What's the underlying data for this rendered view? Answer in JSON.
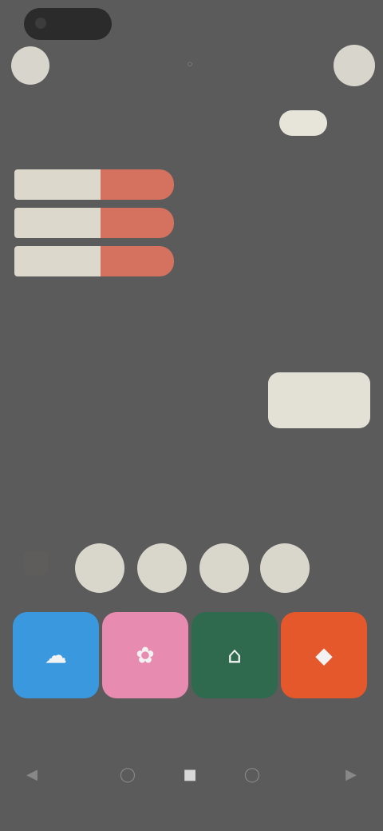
{
  "header": {
    "title": "",
    "center_icon": "◦"
  },
  "palette": {
    "rows": [
      {
        "left_color": "#dcd8cc",
        "right_color": "#d4725f"
      },
      {
        "left_color": "#dcd8cc",
        "right_color": "#d4725f"
      },
      {
        "left_color": "#dcd8cc",
        "right_color": "#d4725f"
      }
    ],
    "caption": ""
  },
  "side": {
    "chip_label": "",
    "items": [
      "",
      "",
      "",
      ""
    ],
    "button_label": ""
  },
  "filters": [
    "",
    "",
    "",
    ""
  ],
  "tiles": [
    {
      "label": "",
      "color": "#3a98de",
      "icon": "☁"
    },
    {
      "label": "",
      "color": "#e88bb0",
      "icon": "✿"
    },
    {
      "label": "",
      "color": "#2f6a4e",
      "icon": "⌂"
    },
    {
      "label": "",
      "color": "#e4582c",
      "icon": "◆"
    }
  ],
  "nav": [
    "◀",
    "◯",
    "■",
    "◯",
    "▶"
  ]
}
